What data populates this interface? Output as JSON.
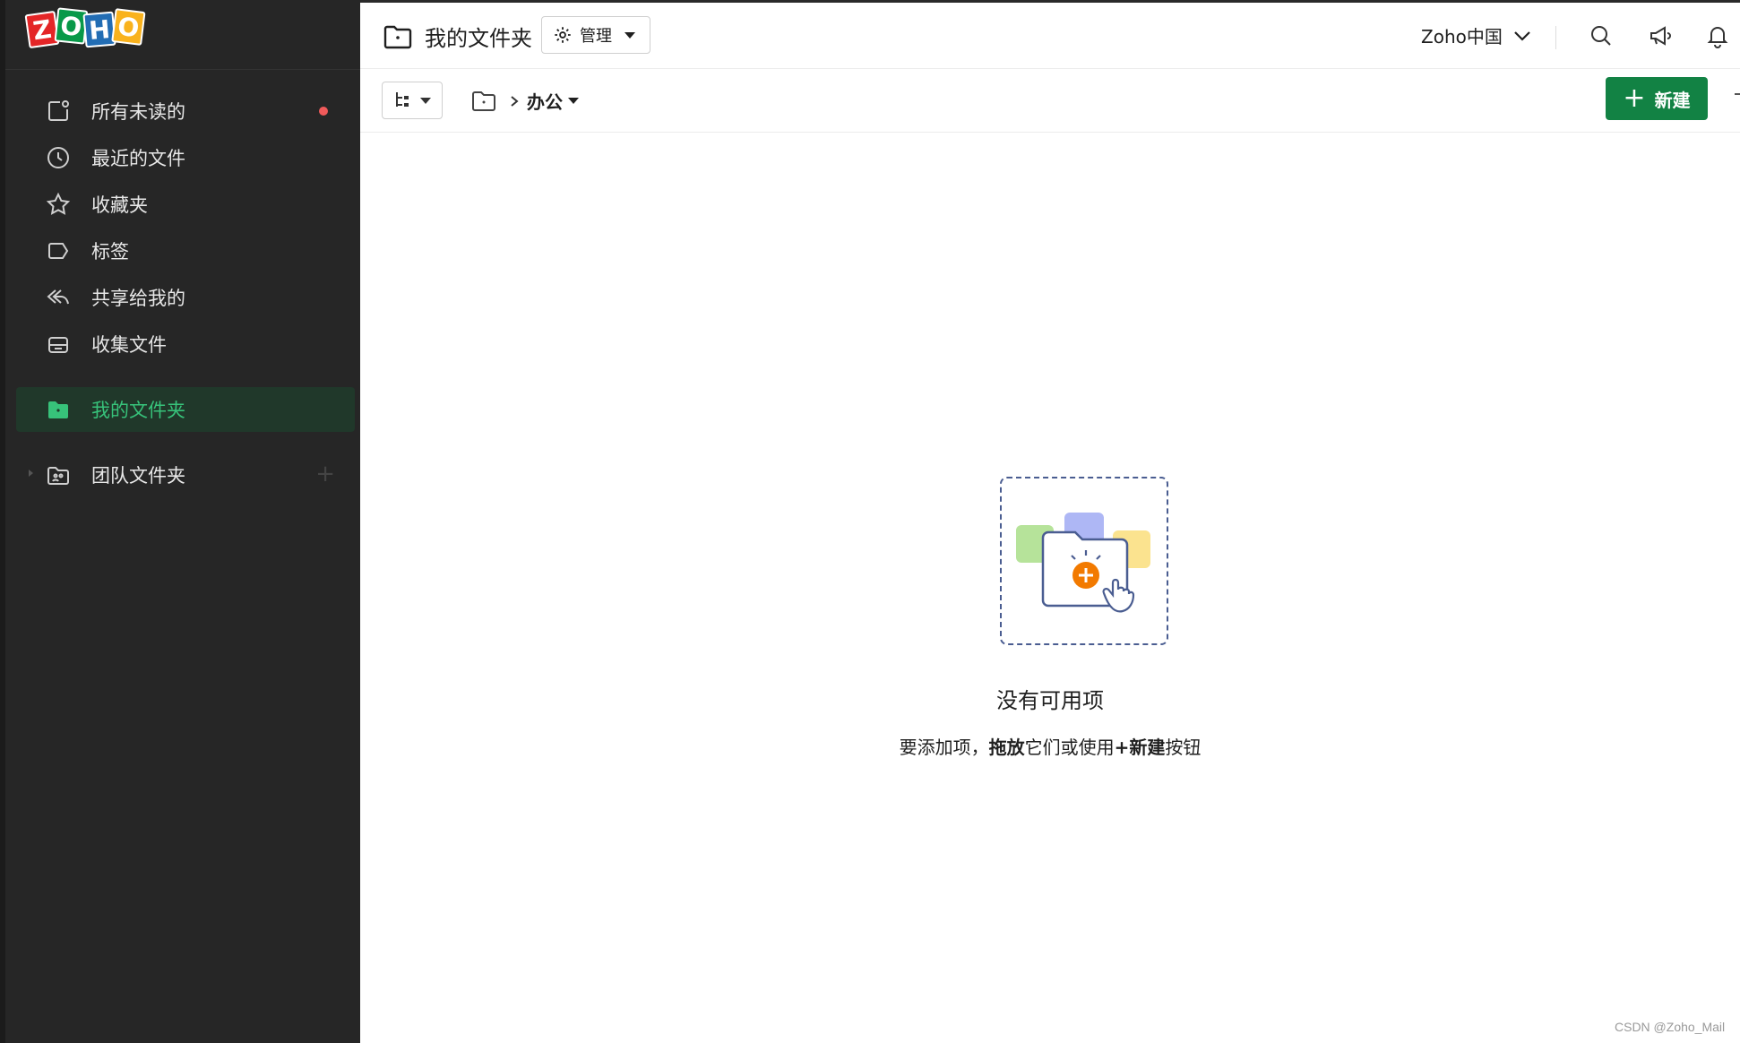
{
  "app": {
    "logo_letters": [
      "Z",
      "O",
      "H",
      "O"
    ],
    "brand_colors": [
      "#e42527",
      "#089949",
      "#226db4",
      "#f9b21d"
    ]
  },
  "sidebar": {
    "items": [
      {
        "label": "所有未读的",
        "icon": "unread-icon",
        "has_dot": true
      },
      {
        "label": "最近的文件",
        "icon": "clock-icon"
      },
      {
        "label": "收藏夹",
        "icon": "star-icon"
      },
      {
        "label": "标签",
        "icon": "tag-icon"
      },
      {
        "label": "共享给我的",
        "icon": "share-reply-icon"
      },
      {
        "label": "收集文件",
        "icon": "inbox-tray-icon"
      }
    ],
    "my_folders": {
      "label": "我的文件夹",
      "icon": "folder-filled-icon",
      "active": true,
      "accent": "#37c27a"
    },
    "team_folders": {
      "label": "团队文件夹",
      "icon": "team-folder-icon"
    }
  },
  "header": {
    "title": "我的文件夹",
    "manage_label": "管理",
    "org_label": "Zoho中国",
    "icons": [
      "search-icon",
      "megaphone-icon",
      "bell-icon"
    ]
  },
  "toolbar": {
    "breadcrumb_current": "办公",
    "new_label": "新建",
    "new_color": "#128244"
  },
  "empty_state": {
    "title": "没有可用项",
    "sub_prefix": "要添加项，",
    "sub_bold1": "拖放",
    "sub_middle": "它们或使用",
    "sub_bold2": "+新建",
    "sub_suffix": "按钮"
  },
  "watermark": "CSDN @Zoho_Mail"
}
